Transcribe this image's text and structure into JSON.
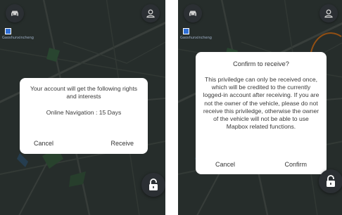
{
  "left": {
    "map_label": "Gaoshunxincheng",
    "dialog": {
      "message": "Your account will get the following rights and interests",
      "detail": "Online Navigation : 15 Days",
      "cancel_label": "Cancel",
      "receive_label": "Receive"
    }
  },
  "right": {
    "map_label": "Gaoshunxincheng",
    "dialog": {
      "title": "Confirm to receive?",
      "body": "This priviledge can only be received once, which will be credited to the currently logged-in account after receiving. If you are not the owner of the vehicle, please do not receive this priviledge, otherwise the owner of the vehicle will not be able to use Mapbox related functions.",
      "cancel_label": "Cancel",
      "confirm_label": "Confirm"
    }
  },
  "icons": {
    "car": "car-icon",
    "user": "user-icon",
    "lock": "unlock-icon",
    "location": "location-marker-icon"
  },
  "colors": {
    "map_bg": "#3a4540",
    "dialog_bg": "#ffffff",
    "button_bg": "#2b2f33",
    "route_orange": "#e07a1e",
    "location_blue": "#2f6fd6"
  }
}
